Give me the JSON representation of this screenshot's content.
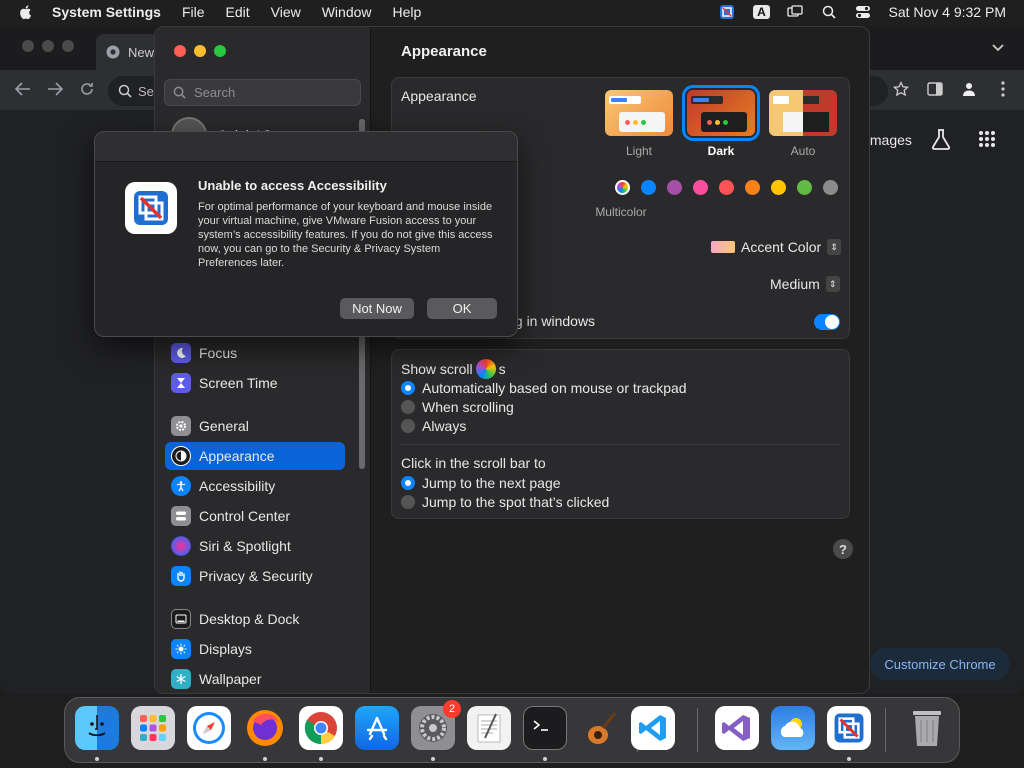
{
  "menubar": {
    "app_name": "System Settings",
    "items": [
      "File",
      "Edit",
      "View",
      "Window",
      "Help"
    ],
    "input_source": "A",
    "clock": "Sat Nov 4  9:32 PM"
  },
  "chrome": {
    "tab_title": "New",
    "omnibox_prefix": "Se",
    "images_link": "Images",
    "customize_button": "Customize Chrome"
  },
  "settings": {
    "search_placeholder": "Search",
    "profile_name": "Caleb Viem",
    "sidebar": [
      {
        "label": "Focus",
        "icon": "moon-icon",
        "color": "#5e5ce6"
      },
      {
        "label": "Screen Time",
        "icon": "hourglass-icon",
        "color": "#5e5ce6"
      },
      {
        "label": "General",
        "icon": "gear-icon",
        "color": "#8e8e93"
      },
      {
        "label": "Appearance",
        "icon": "appearance-icon",
        "color": "#1c1c1e",
        "active": true
      },
      {
        "label": "Accessibility",
        "icon": "accessibility-icon",
        "color": "#0a84ff"
      },
      {
        "label": "Control Center",
        "icon": "control-center-icon",
        "color": "#8e8e93"
      },
      {
        "label": "Siri & Spotlight",
        "icon": "siri-icon",
        "color": "#bf5af2"
      },
      {
        "label": "Privacy & Security",
        "icon": "hand-icon",
        "color": "#0a84ff"
      },
      {
        "label": "Desktop & Dock",
        "icon": "dock-icon",
        "color": "#1c1c1e"
      },
      {
        "label": "Displays",
        "icon": "sun-icon",
        "color": "#0a84ff"
      },
      {
        "label": "Wallpaper",
        "icon": "snowflake-icon",
        "color": "#30b0c7"
      }
    ],
    "main_title": "Appearance",
    "appearance_label": "Appearance",
    "themes": [
      {
        "label": "Light",
        "selected": false
      },
      {
        "label": "Dark",
        "selected": true
      },
      {
        "label": "Auto",
        "selected": false
      }
    ],
    "accent_colors": [
      "multicolor",
      "#0a84ff",
      "#a550a7",
      "#f74f9e",
      "#ff5257",
      "#f7821b",
      "#ffc600",
      "#62ba46",
      "#8c8c8c"
    ],
    "multicolor_label": "Multicolor",
    "highlight_value": "Accent Color",
    "sidebar_icon_size_value": "Medium",
    "wallpaper_tinting_label": "ing in windows",
    "wallpaper_tinting_on": true,
    "show_scroll_label_prefix": "Show scroll",
    "show_scroll_label_suffix": "s",
    "scroll_options": [
      {
        "label": "Automatically based on mouse or trackpad",
        "selected": true
      },
      {
        "label": "When scrolling",
        "selected": false
      },
      {
        "label": "Always",
        "selected": false
      }
    ],
    "click_scroll_label": "Click in the scroll bar to",
    "click_options": [
      {
        "label": "Jump to the next page",
        "selected": true
      },
      {
        "label": "Jump to the spot that’s clicked",
        "selected": false
      }
    ],
    "help": "?"
  },
  "dialog": {
    "title": "Unable to access Accessibility",
    "body": "For optimal performance of your keyboard and mouse inside your virtual machine, give VMware Fusion access to your system’s accessibility features. If you do not give this access now, you can go to the Security & Privacy System Preferences later.",
    "secondary_button": "Not Now",
    "primary_button": "OK"
  },
  "dock": {
    "apps": [
      "finder-icon",
      "launchpad-icon",
      "safari-icon",
      "firefox-icon",
      "chrome-icon",
      "app-store-icon",
      "system-settings-icon",
      "textedit-icon",
      "terminal-icon",
      "garageband-icon",
      "vscode-icon",
      "visual-studio-icon",
      "weather-icon",
      "vmware-fusion-icon",
      "trash-icon"
    ],
    "settings_badge": "2"
  }
}
